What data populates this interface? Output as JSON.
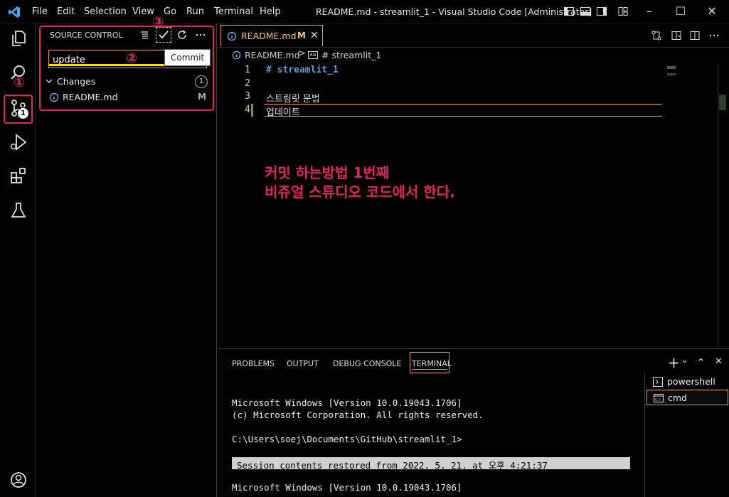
{
  "menu": [
    "File",
    "Edit",
    "Selection",
    "View",
    "Go",
    "Run",
    "Terminal",
    "Help"
  ],
  "window_title": "README.md - streamlit_1 - Visual Studio Code [Administrator]",
  "window_buttons": {
    "minimize": "–",
    "maximize": "☐",
    "close": "✕"
  },
  "activity_bar": {
    "items": [
      "explorer-icon",
      "search-icon",
      "source-control-icon",
      "run-debug-icon",
      "extensions-icon",
      "testing-icon",
      "account-icon"
    ],
    "scm_badge": "1"
  },
  "sidebar": {
    "title": "SOURCE CONTROL",
    "commit_message": "update",
    "tooltip": "Commit",
    "changes_label": "Changes",
    "changes_count": "1",
    "file_name": "README.md",
    "file_status": "M"
  },
  "annotations": {
    "step1": "①",
    "step2": "②",
    "step3": "③"
  },
  "editor": {
    "tab_label": "README.md",
    "tab_modified": "M",
    "tab_close": "✕",
    "breadcrumb_file": "README.md",
    "breadcrumb_sep": ">",
    "breadcrumb_heading": "# streamlit_1",
    "lines": [
      {
        "num": "1",
        "text": "# streamlit_1"
      },
      {
        "num": "2",
        "text": ""
      },
      {
        "num": "3",
        "text": "스트림릿 문법"
      },
      {
        "num": "4",
        "text": "업데이트"
      }
    ],
    "note_line1": "커밋 하는방법 1번째",
    "note_line2": "비쥬얼 스튜디오 코드에서 한다."
  },
  "panel": {
    "tabs": [
      "PROBLEMS",
      "OUTPUT",
      "DEBUG CONSOLE",
      "TERMINAL"
    ],
    "active_tab": "TERMINAL",
    "terminal_lines": [
      "Microsoft Windows [Version 10.0.19043.1706]",
      "(c) Microsoft Corporation. All rights reserved.",
      "C:\\Users\\soej\\Documents\\GitHub\\streamlit_1>",
      "Microsoft Windows [Version 10.0.19043.1706]"
    ],
    "session_restored": "Session contents restored from 2022. 5. 21. at 오후 4:21:37",
    "terminals": [
      "powershell",
      "cmd"
    ],
    "tools": {
      "add": "+",
      "dropdown": "⌄",
      "maximize": "⌃",
      "close": "✕"
    }
  },
  "colors": {
    "highlight": "#e0245e",
    "modified": "#f0c674",
    "accent": "#e5a04a",
    "comment": "#569cd6"
  }
}
